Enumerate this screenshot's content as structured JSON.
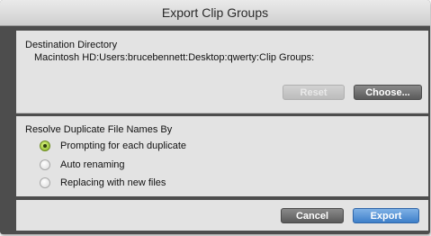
{
  "dialog": {
    "title": "Export Clip Groups"
  },
  "destination": {
    "heading": "Destination Directory",
    "path": "Macintosh HD:Users:brucebennett:Desktop:qwerty:Clip Groups:",
    "reset_label": "Reset",
    "choose_label": "Choose..."
  },
  "resolve": {
    "heading": "Resolve Duplicate File Names By",
    "options": [
      {
        "label": "Prompting for each duplicate",
        "selected": true
      },
      {
        "label": "Auto renaming",
        "selected": false
      },
      {
        "label": "Replacing with new files",
        "selected": false
      }
    ]
  },
  "footer": {
    "cancel_label": "Cancel",
    "export_label": "Export"
  },
  "colors": {
    "accent_radio": "#86b22a",
    "primary_button": "#3e7fc9",
    "window_frame": "#4d4d4d"
  }
}
